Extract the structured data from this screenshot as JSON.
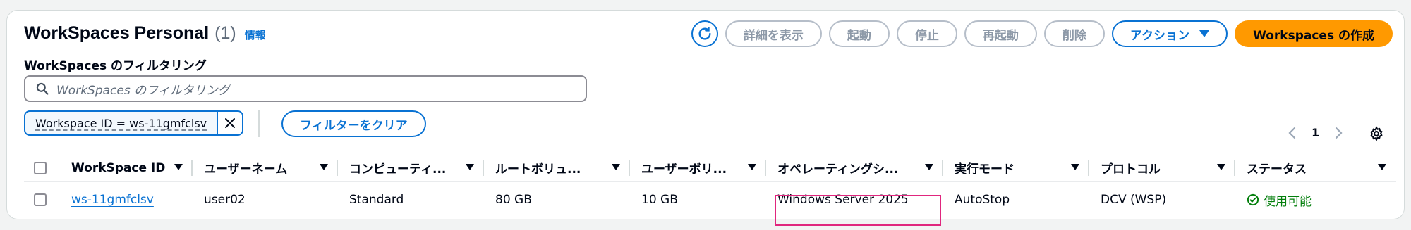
{
  "header": {
    "title": "WorkSpaces Personal",
    "count": "(1)",
    "info_link": "情報"
  },
  "toolbar": {
    "refresh": "refresh-icon",
    "details_label": "詳細を表示",
    "start_label": "起動",
    "stop_label": "停止",
    "reboot_label": "再起動",
    "delete_label": "削除",
    "actions_label": "アクション",
    "create_label": "Workspaces の作成"
  },
  "filter": {
    "label": "WorkSpaces のフィルタリング",
    "placeholder": "WorkSpaces のフィルタリング",
    "token": "Workspace ID = ws-11gmfclsv",
    "clear_label": "フィルターをクリア"
  },
  "pagination": {
    "current_page": "1"
  },
  "table": {
    "columns": [
      "WorkSpace ID",
      "ユーザーネーム",
      "コンピューティ...",
      "ルートボリュ...",
      "ユーザーボリ...",
      "オペレーティングシ...",
      "実行モード",
      "プロトコル",
      "ステータス"
    ],
    "rows": [
      {
        "id": "ws-11gmfclsv",
        "username": "user02",
        "compute": "Standard",
        "root_volume": "80 GB",
        "user_volume": "10 GB",
        "os": "Windows Server 2025",
        "running_mode": "AutoStop",
        "protocol": "DCV (WSP)",
        "status": "使用可能"
      }
    ]
  },
  "colors": {
    "accent": "#0972d3",
    "primary_button": "#ff9900",
    "success": "#037f0c",
    "highlight": "#e0267e"
  }
}
